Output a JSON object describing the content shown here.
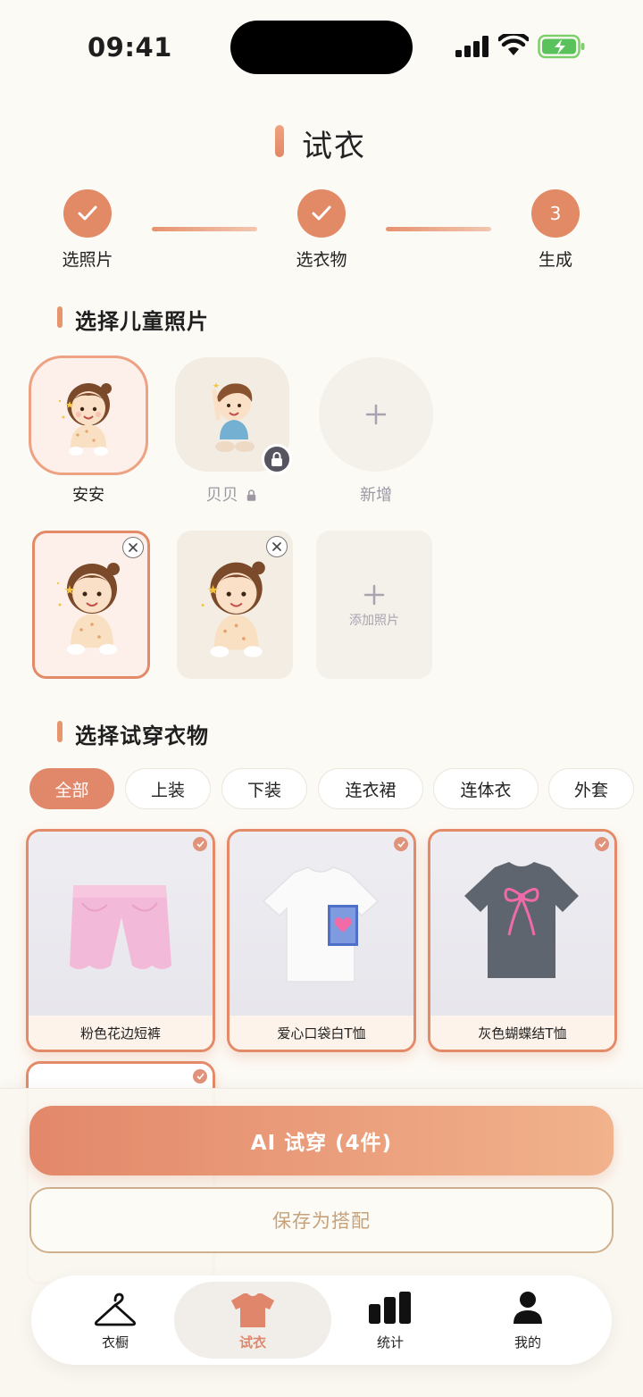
{
  "status": {
    "time": "09:41"
  },
  "header": {
    "title": "试衣"
  },
  "steps": [
    {
      "label": "选照片",
      "state": "done"
    },
    {
      "label": "选衣物",
      "state": "done"
    },
    {
      "label": "生成",
      "number": "3",
      "state": "current"
    }
  ],
  "child_section": {
    "title": "选择儿童照片",
    "children": [
      {
        "name": "安安",
        "selected": true
      },
      {
        "name": "贝贝",
        "locked": true
      },
      {
        "name": "新增",
        "is_add": true
      }
    ],
    "add_photo_label": "添加照片"
  },
  "clothes_section": {
    "title": "选择试穿衣物",
    "filters": [
      "全部",
      "上装",
      "下装",
      "连衣裙",
      "连体衣",
      "外套"
    ],
    "active_filter": "全部",
    "items": [
      {
        "name": "粉色花边短裤",
        "selected": true
      },
      {
        "name": "爱心口袋白T恤",
        "selected": true
      },
      {
        "name": "灰色蝴蝶结T恤",
        "selected": true
      },
      {
        "name": "",
        "selected": true
      }
    ]
  },
  "actions": {
    "try_on": "AI 试穿 (4件)",
    "save": "保存为搭配"
  },
  "tabbar": {
    "items": [
      {
        "label": "衣橱",
        "icon": "hanger-icon"
      },
      {
        "label": "试衣",
        "icon": "tshirt-icon",
        "active": true
      },
      {
        "label": "统计",
        "icon": "bar-chart-icon"
      },
      {
        "label": "我的",
        "icon": "person-icon"
      }
    ]
  },
  "colors": {
    "accent": "#e28a66",
    "background": "#fcfaf5",
    "gold": "#c6a27c"
  }
}
